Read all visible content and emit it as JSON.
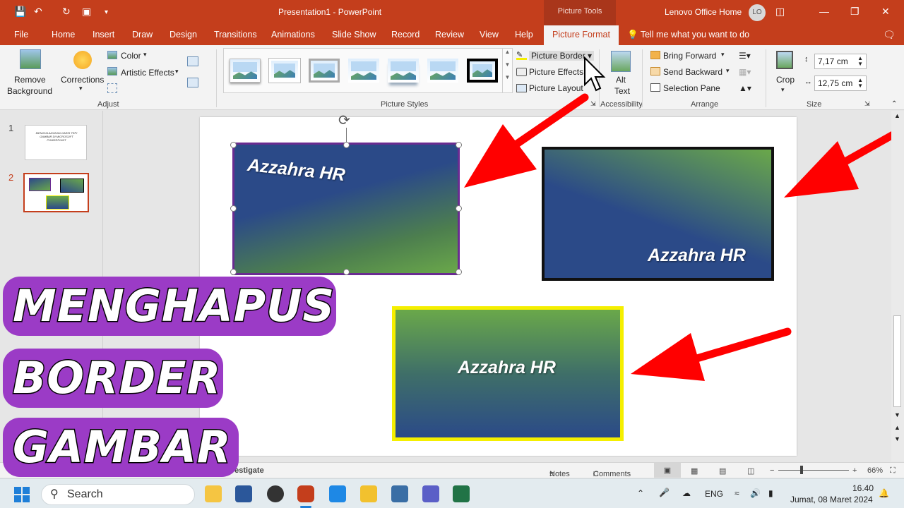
{
  "titlebar": {
    "title": "Presentation1  -  PowerPoint",
    "context_tab": "Picture Tools",
    "account": "Lenovo Office Home",
    "avatar_initials": "LO"
  },
  "menu": {
    "tabs": [
      "File",
      "Home",
      "Insert",
      "Draw",
      "Design",
      "Transitions",
      "Animations",
      "Slide Show",
      "Record",
      "Review",
      "View",
      "Help",
      "Picture Format"
    ],
    "tell_me": "Tell me what you want to do"
  },
  "ribbon": {
    "adjust": {
      "remove_bg_line1": "Remove",
      "remove_bg_line2": "Background",
      "corrections": "Corrections",
      "color": "Color",
      "artistic_effects": "Artistic Effects",
      "label": "Adjust"
    },
    "picture_styles": {
      "border": "Picture Border",
      "effects": "Picture Effects",
      "layout": "Picture Layout",
      "label": "Picture Styles"
    },
    "accessibility": {
      "alt_line1": "Alt",
      "alt_line2": "Text",
      "label": "Accessibility"
    },
    "arrange": {
      "bring_forward": "Bring Forward",
      "send_backward": "Send Backward",
      "selection_pane": "Selection Pane",
      "label": "Arrange"
    },
    "size": {
      "crop": "Crop",
      "height": "7,17 cm",
      "width": "12,75 cm",
      "label": "Size"
    }
  },
  "slides_panel": {
    "slide1_num": "1",
    "slide1_text": "MENGHILANGKAN GARIS TEPI GAMBAR DI MICROSOFT POWERPOINT",
    "slide2_num": "2"
  },
  "slide": {
    "pic1_label": "Azzahra HR",
    "pic2_label": "Azzahra HR",
    "pic3_label": "Azzahra HR",
    "pic1_border": "#6a2c91",
    "pic2_border": "#111111",
    "pic3_border": "#f5ef00"
  },
  "overlay": {
    "line1": "MENGHAPUS",
    "line2": "BORDER",
    "line3": "GAMBAR"
  },
  "statusbar": {
    "accessibility": "vestigate",
    "notes": "Notes",
    "comments": "Comments",
    "zoom": "66%"
  },
  "taskbar": {
    "search": "Search",
    "lang": "ENG",
    "time": "16.40",
    "date": "Jumat, 08 Maret 2024"
  },
  "colors": {
    "accent": "#c43e1c",
    "overlay_purple": "#9b3bc6",
    "arrow_red": "#ff0000"
  }
}
